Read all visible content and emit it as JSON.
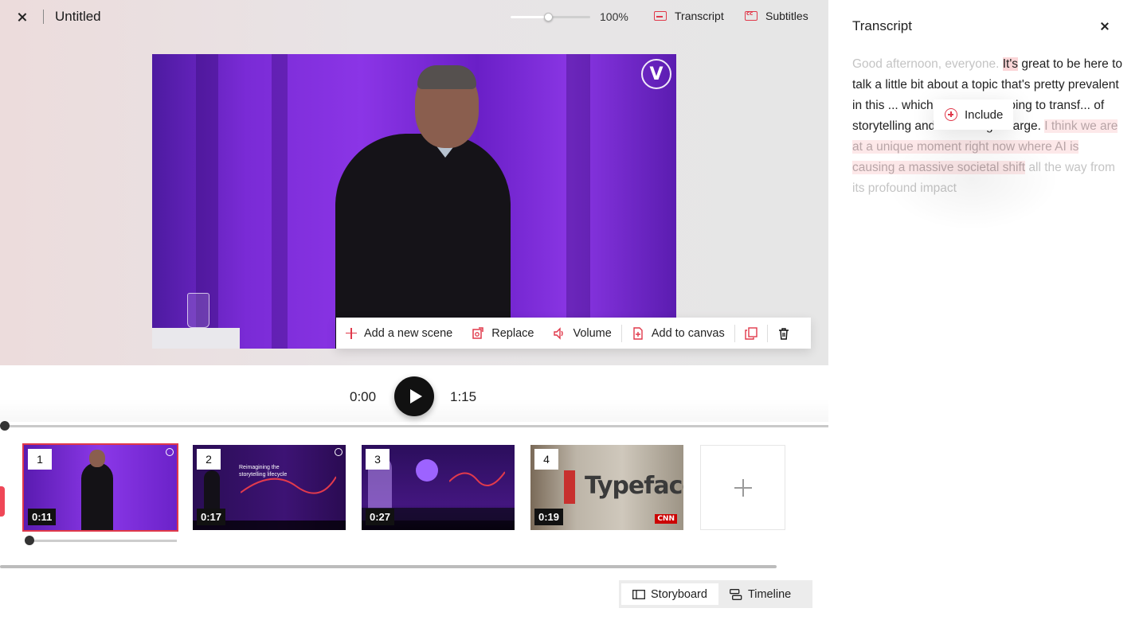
{
  "topbar": {
    "title": "Untitled",
    "zoom": {
      "level": "100%",
      "fraction": 0.47
    },
    "transcript_label": "Transcript",
    "subtitles_label": "Subtitles"
  },
  "scene_toolbar": {
    "add_scene": "Add a new scene",
    "replace": "Replace",
    "volume": "Volume",
    "add_to_canvas": "Add to canvas"
  },
  "player": {
    "current_time": "0:00",
    "total_time": "1:15",
    "progress_fraction": 0
  },
  "scenes": [
    {
      "number": "1",
      "duration": "0:11",
      "selected": true
    },
    {
      "number": "2",
      "duration": "0:17",
      "slide_title": "Reimagining the storytelling lifecycle"
    },
    {
      "number": "3",
      "duration": "0:27"
    },
    {
      "number": "4",
      "duration": "0:19",
      "sign_text": "Typeface",
      "badge": "CNN"
    }
  ],
  "view_toggle": {
    "storyboard": "Storyboard",
    "timeline": "Timeline",
    "active": "storyboard"
  },
  "transcript": {
    "title": "Transcript",
    "segments": [
      {
        "text": "Good afternoon, everyone. ",
        "state": "excluded"
      },
      {
        "text": "It's",
        "state": "highlight"
      },
      {
        "text": " great to be here to talk a little bit about a topic that's pretty prevalent in this ... which is how AI is going to transf... of storytelling and marketing at large. ",
        "state": "included"
      },
      {
        "text": "I think we are at a unique moment right now where AI is causing a massive societal shift",
        "state": "highlight-excluded"
      },
      {
        "text": " all the way from its profound impact",
        "state": "excluded"
      }
    ],
    "include_popup": "Include"
  },
  "colors": {
    "accent": "#e0384a",
    "highlight": "#fbd6d8",
    "excluded_text": "#c4c4c4"
  }
}
